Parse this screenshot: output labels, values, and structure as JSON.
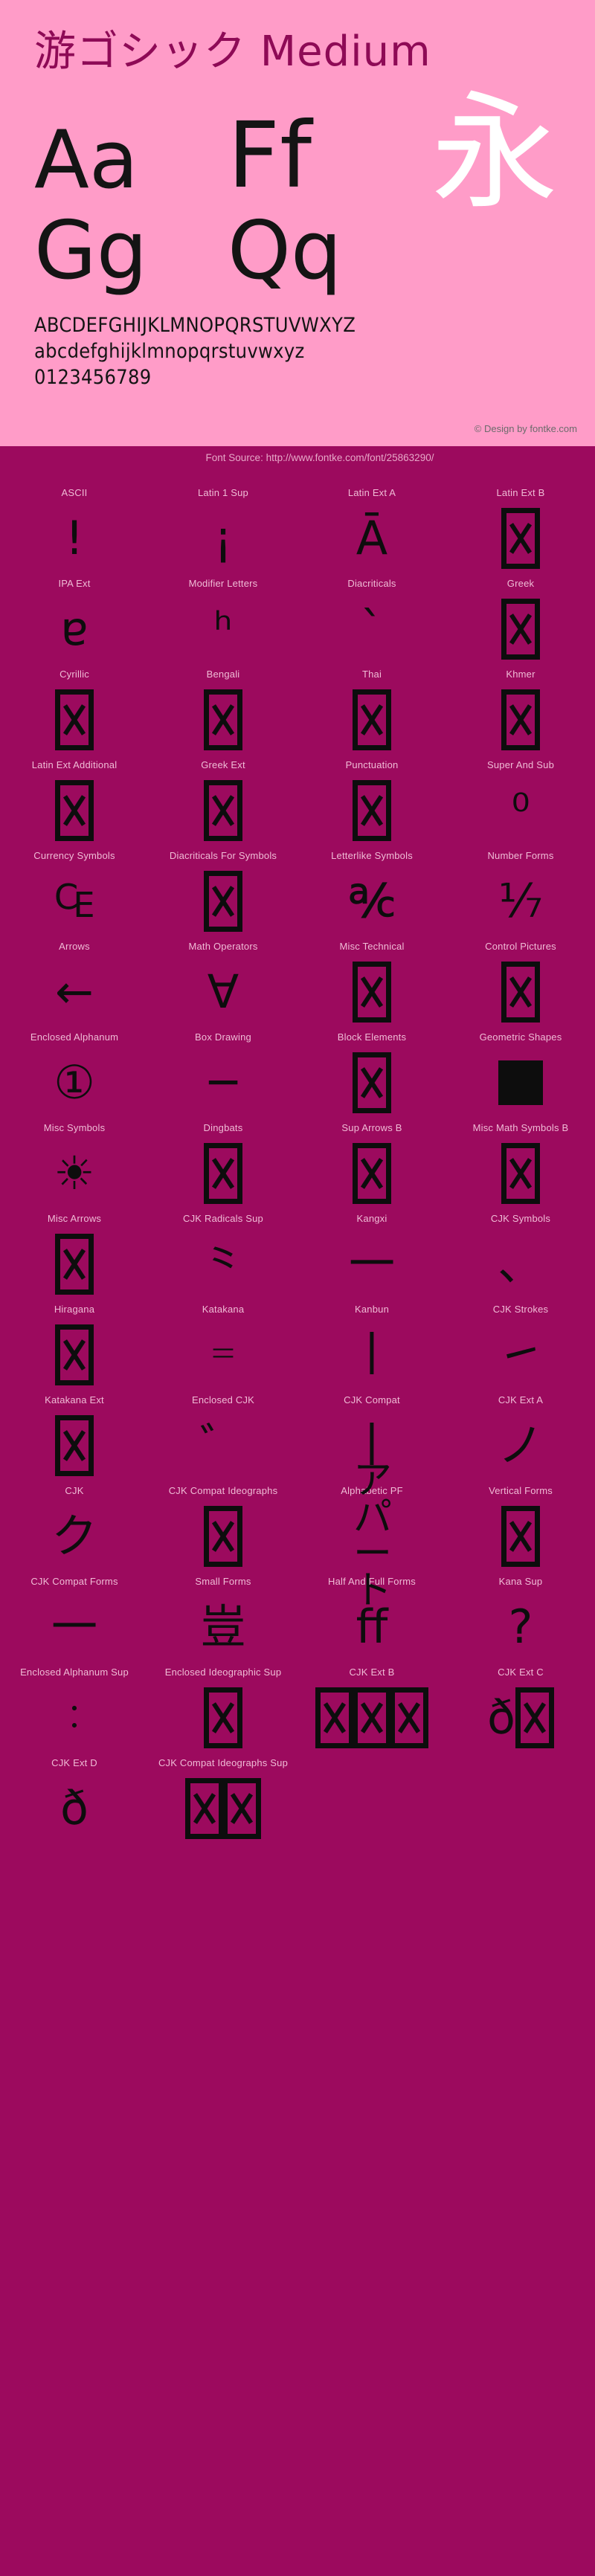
{
  "header": {
    "font_title": "游ゴシック Medium",
    "specimens": [
      {
        "text": "Aa",
        "kind": "latin"
      },
      {
        "text": "Ff",
        "kind": "latin"
      },
      {
        "text": "Gg",
        "kind": "latin"
      },
      {
        "text": "Qq",
        "kind": "latin"
      },
      {
        "text": "永",
        "kind": "cjk"
      }
    ],
    "alphabet_upper": "ABCDEFGHIJKLMNOPQRSTUVWXYZ",
    "alphabet_lower": "abcdefghijklmnopqrstuvwxyz",
    "digits": "0123456789",
    "credit": "© Design by fontke.com",
    "source": "Font Source: http://www.fontke.com/font/25863290/"
  },
  "colors": {
    "header_bg": "#ff9cc8",
    "page_bg": "#9c0a5e",
    "title": "#8e0a56",
    "glyph": "#0d0d0d",
    "label": "#f0bcd6",
    "credit": "#6b6b6b",
    "source_text": "#e7a8c8",
    "cjk_specimen": "#ffffff"
  },
  "blocks": [
    {
      "label": "ASCII",
      "sample": "!",
      "render": "text",
      "size": "normal"
    },
    {
      "label": "Latin 1 Sup",
      "sample": "¡",
      "render": "text",
      "size": "normal"
    },
    {
      "label": "Latin Ext A",
      "sample": "Ā",
      "render": "text",
      "size": "normal"
    },
    {
      "label": "Latin Ext B",
      "sample": "",
      "render": "tofu",
      "size": "normal"
    },
    {
      "label": "IPA Ext",
      "sample": "ɐ",
      "render": "text",
      "size": "normal"
    },
    {
      "label": "Modifier Letters",
      "sample": "ʰ",
      "render": "text",
      "size": "normal"
    },
    {
      "label": "Diacriticals",
      "sample": "`",
      "render": "text",
      "size": "normal"
    },
    {
      "label": "Greek",
      "sample": "",
      "render": "tofu",
      "size": "normal"
    },
    {
      "label": "Cyrillic",
      "sample": "",
      "render": "tofu",
      "size": "normal"
    },
    {
      "label": "Bengali",
      "sample": "",
      "render": "tofu",
      "size": "normal"
    },
    {
      "label": "Thai",
      "sample": "",
      "render": "tofu",
      "size": "normal"
    },
    {
      "label": "Khmer",
      "sample": "",
      "render": "tofu",
      "size": "normal"
    },
    {
      "label": "Latin Ext Additional",
      "sample": "",
      "render": "tofu",
      "size": "normal"
    },
    {
      "label": "Greek Ext",
      "sample": "",
      "render": "tofu",
      "size": "normal"
    },
    {
      "label": "Punctuation",
      "sample": "",
      "render": "tofu",
      "size": "normal"
    },
    {
      "label": "Super And Sub",
      "sample": "⁰",
      "render": "text",
      "size": "normal"
    },
    {
      "label": "Currency Symbols",
      "sample": "₠",
      "render": "text",
      "size": "normal"
    },
    {
      "label": "Diacriticals For Symbols",
      "sample": "",
      "render": "tofu",
      "size": "normal"
    },
    {
      "label": "Letterlike Symbols",
      "sample": "℀",
      "render": "text",
      "size": "normal"
    },
    {
      "label": "Number Forms",
      "sample": "⅐",
      "render": "text",
      "size": "normal"
    },
    {
      "label": "Arrows",
      "sample": "←",
      "render": "text",
      "size": "normal"
    },
    {
      "label": "Math Operators",
      "sample": "∀",
      "render": "text",
      "size": "normal"
    },
    {
      "label": "Misc Technical",
      "sample": "",
      "render": "tofu",
      "size": "normal"
    },
    {
      "label": "Control Pictures",
      "sample": "",
      "render": "tofu",
      "size": "normal"
    },
    {
      "label": "Enclosed Alphanum",
      "sample": "①",
      "render": "text",
      "size": "normal"
    },
    {
      "label": "Box Drawing",
      "sample": "─",
      "render": "text",
      "size": "normal"
    },
    {
      "label": "Block Elements",
      "sample": "",
      "render": "tofu",
      "size": "normal"
    },
    {
      "label": "Geometric Shapes",
      "sample": "",
      "render": "black",
      "size": "normal"
    },
    {
      "label": "Misc Symbols",
      "sample": "☀",
      "render": "text",
      "size": "normal"
    },
    {
      "label": "Dingbats",
      "sample": "",
      "render": "tofu",
      "size": "normal"
    },
    {
      "label": "Sup Arrows B",
      "sample": "",
      "render": "tofu",
      "size": "normal"
    },
    {
      "label": "Misc Math Symbols B",
      "sample": "",
      "render": "tofu",
      "size": "normal"
    },
    {
      "label": "Misc Arrows",
      "sample": "",
      "render": "tofu",
      "size": "normal"
    },
    {
      "label": "CJK Radicals Sup",
      "sample": "⺀",
      "render": "text",
      "size": "normal"
    },
    {
      "label": "Kangxi",
      "sample": "⼀",
      "render": "text",
      "size": "normal"
    },
    {
      "label": "CJK Symbols",
      "sample": "、",
      "render": "text",
      "size": "normal"
    },
    {
      "label": "Hiragana",
      "sample": "",
      "render": "tofu",
      "size": "normal"
    },
    {
      "label": "Katakana",
      "sample": "゠",
      "render": "text",
      "size": "normal"
    },
    {
      "label": "Kanbun",
      "sample": "丨",
      "render": "text",
      "size": "normal"
    },
    {
      "label": "CJK Strokes",
      "sample": "㇀",
      "render": "text",
      "size": "normal"
    },
    {
      "label": "Katakana Ext",
      "sample": "",
      "render": "tofu",
      "size": "normal"
    },
    {
      "label": "Enclosed CJK",
      "sample": "゛",
      "render": "text",
      "size": "normal"
    },
    {
      "label": "CJK Compat",
      "sample": "丨",
      "render": "text",
      "size": "normal"
    },
    {
      "label": "CJK Ext A",
      "sample": "ノ",
      "render": "text",
      "size": "normal"
    },
    {
      "label": "CJK",
      "sample": "ク",
      "render": "text",
      "size": "normal"
    },
    {
      "label": "CJK Compat Ideographs",
      "sample": "",
      "render": "tofu",
      "size": "normal"
    },
    {
      "label": "Alphabetic PF",
      "sample": "アパート",
      "render": "text",
      "size": "wrap"
    },
    {
      "label": "Vertical Forms",
      "sample": "",
      "render": "tofu",
      "size": "normal"
    },
    {
      "label": "CJK Compat Forms",
      "sample": "一",
      "render": "text",
      "size": "normal"
    },
    {
      "label": "Small Forms",
      "sample": "豈",
      "render": "text",
      "size": "normal"
    },
    {
      "label": "Half And Full Forms",
      "sample": "ﬀ",
      "render": "text",
      "size": "normal"
    },
    {
      "label": "Kana Sup",
      "sample": "?",
      "render": "text",
      "size": "normal"
    },
    {
      "label": "Enclosed Alphanum Sup",
      "sample": "︰",
      "render": "text",
      "size": "small"
    },
    {
      "label": "Enclosed Ideographic Sup",
      "sample": "",
      "render": "tofu",
      "size": "normal"
    },
    {
      "label": "CJK Ext B",
      "sample": "",
      "render": "tofu",
      "size": "normal"
    },
    {
      "label": "CJK Ext C",
      "sample": "ð",
      "render": "mixed",
      "size": "normal"
    },
    {
      "label": "CJK Ext D",
      "sample": "ð",
      "render": "text",
      "size": "normal"
    },
    {
      "label": "CJK Compat Ideographs Sup",
      "sample": "",
      "render": "tofu",
      "size": "normal"
    }
  ],
  "grid_rows": [
    {
      "row": 1,
      "labels": [
        "ASCII",
        "Latin 1 Sup",
        "Latin Ext A",
        "Latin Ext B"
      ]
    },
    {
      "row": 2,
      "labels": [
        "IPA Ext",
        "Modifier Letters",
        "Diacriticals",
        "Greek"
      ]
    },
    {
      "row": 3,
      "labels": [
        "Cyrillic",
        "Bengali",
        "Thai",
        "Khmer"
      ]
    },
    {
      "row": 4,
      "labels": [
        "Latin Ext Additional",
        "Greek Ext",
        "Punctuation",
        "Super And Sub"
      ]
    },
    {
      "row": 5,
      "labels": [
        "Currency Symbols",
        "Diacriticals For Symbols",
        "Letterlike Symbols",
        "Number Forms"
      ]
    },
    {
      "row": 6,
      "labels": [
        "Arrows",
        "Math Operators",
        "Misc Technical",
        "Control Pictures"
      ]
    },
    {
      "row": 7,
      "labels": [
        "Enclosed Alphanum",
        "Box Drawing",
        "Block Elements",
        "Geometric Shapes"
      ]
    },
    {
      "row": 8,
      "labels": [
        "Misc Symbols",
        "Dingbats",
        "Sup Arrows B",
        "Misc Math Symbols B"
      ]
    },
    {
      "row": 9,
      "labels": [
        "Misc Arrows",
        "CJK Radicals Sup",
        "Kangxi",
        "CJK Symbols"
      ]
    },
    {
      "row": 10,
      "labels": [
        "Hiragana",
        "Katakana",
        "Kanbun",
        "CJK Strokes"
      ]
    },
    {
      "row": 11,
      "labels": [
        "Katakana Ext",
        "Enclosed CJK",
        "CJK Compat",
        "CJK Ext A"
      ]
    },
    {
      "row": 12,
      "labels": [
        "CJK",
        "CJK Compat Ideographs",
        "Alphabetic PF",
        "Vertical Forms"
      ]
    },
    {
      "row": 13,
      "labels": [
        "CJK Compat Forms",
        "Small Forms",
        "Half And Full Forms",
        "Kana Sup"
      ]
    },
    {
      "row": 14,
      "labels": [
        "Enclosed Alphanum Sup",
        "Enclosed Ideographic Sup",
        "CJK Ext B",
        "CJK Ext C"
      ]
    },
    {
      "row": 15,
      "labels": [
        "CJK Ext D",
        "CJK Compat Ideographs Sup"
      ]
    }
  ]
}
